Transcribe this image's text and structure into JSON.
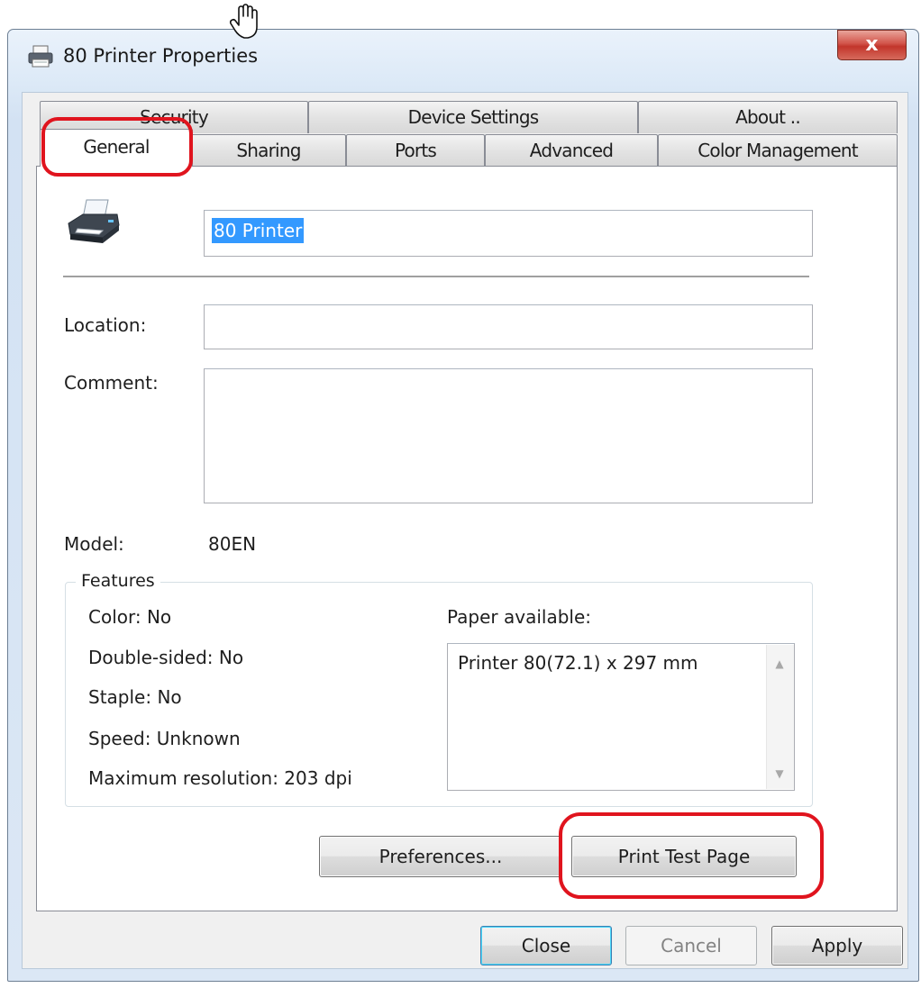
{
  "window": {
    "title": "80 Printer Properties",
    "close_glyph": "x",
    "icon": "printer-icon"
  },
  "tabs": {
    "row_back": [
      {
        "label": "Security"
      },
      {
        "label": "Device Settings"
      },
      {
        "label": "About .."
      }
    ],
    "row_front": [
      {
        "label": "General",
        "active": true
      },
      {
        "label": "Sharing"
      },
      {
        "label": "Ports"
      },
      {
        "label": "Advanced"
      },
      {
        "label": "Color Management"
      }
    ]
  },
  "general": {
    "printer_name": "80 Printer",
    "location_label": "Location:",
    "location_value": "",
    "comment_label": "Comment:",
    "comment_value": "",
    "model_label": "Model:",
    "model_value": "80EN",
    "features": {
      "title": "Features",
      "color": "Color: No",
      "double_sided": "Double-sided: No",
      "staple": "Staple: No",
      "speed": "Speed: Unknown",
      "max_resolution": "Maximum resolution: 203 dpi",
      "paper_label": "Paper available:",
      "paper_items": [
        "Printer 80(72.1) x 297 mm"
      ]
    },
    "preferences_button": "Preferences...",
    "print_test_button": "Print Test Page"
  },
  "footer": {
    "close": "Close",
    "cancel": "Cancel",
    "apply": "Apply"
  },
  "colors": {
    "highlight": "#e0141e",
    "selection": "#3399ff"
  }
}
